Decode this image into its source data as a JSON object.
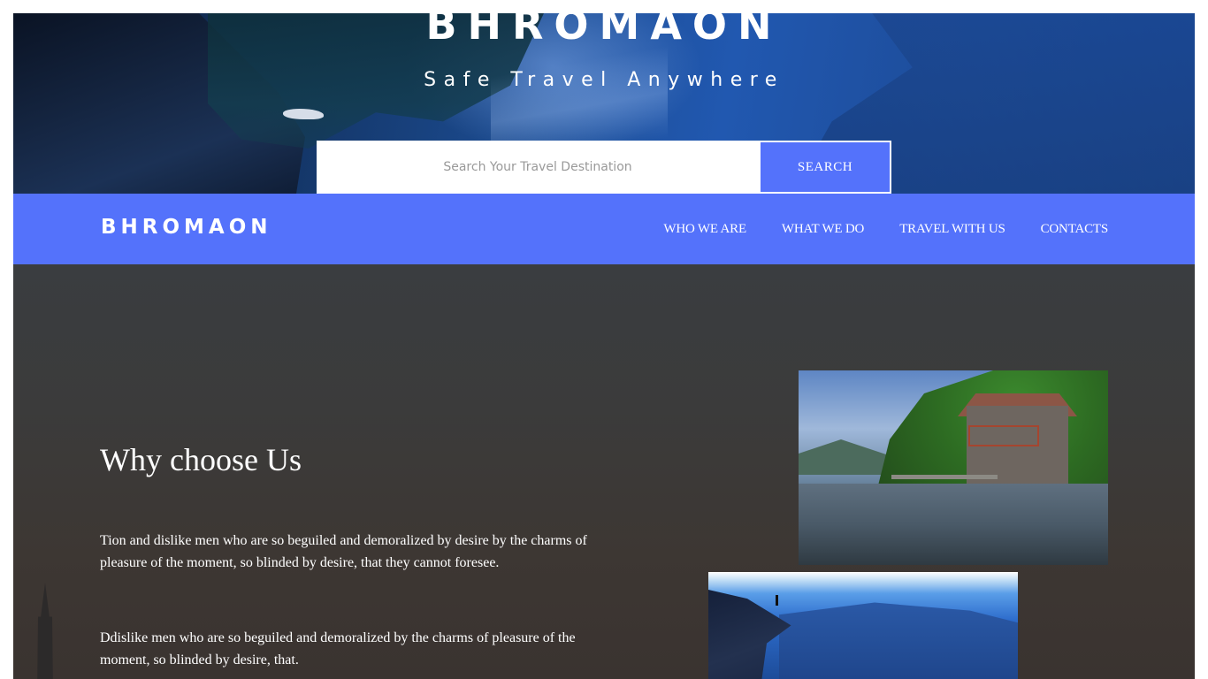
{
  "hero": {
    "title": "BHROMAON",
    "tagline": "Safe Travel Anywhere"
  },
  "search": {
    "placeholder": "Search Your Travel Destination",
    "button_label": "SEARCH"
  },
  "navbar": {
    "brand": "BHROMAON",
    "links": [
      {
        "label": "WHO WE ARE"
      },
      {
        "label": "WHAT WE DO"
      },
      {
        "label": "TRAVEL WITH US"
      },
      {
        "label": "CONTACTS"
      }
    ]
  },
  "why_choose": {
    "title": "Why choose Us",
    "paragraphs": [
      "Tion and dislike men who are so beguiled and demoralized by desire by the charms of pleasure of the moment, so blinded by desire, that they cannot foresee.",
      "Ddislike men who are so beguiled and demoralized by the charms of pleasure of the moment, so blinded by desire, that."
    ]
  },
  "colors": {
    "accent": "#5472fb",
    "content_bg": "#3b3b3b",
    "text": "#ffffff"
  }
}
